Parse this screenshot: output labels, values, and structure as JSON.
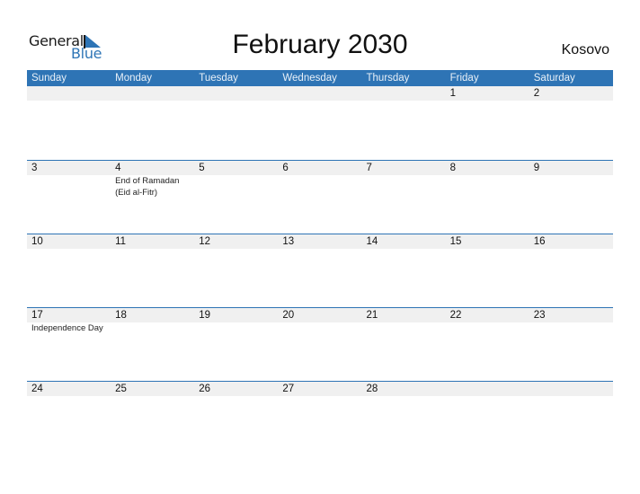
{
  "logo": {
    "part1": "General",
    "part2": "Blue"
  },
  "title": "February 2030",
  "country": "Kosovo",
  "colors": {
    "accent": "#2e74b5",
    "band": "#f0f0f0"
  },
  "weekdays": [
    "Sunday",
    "Monday",
    "Tuesday",
    "Wednesday",
    "Thursday",
    "Friday",
    "Saturday"
  ],
  "weeks": [
    [
      {
        "day": ""
      },
      {
        "day": ""
      },
      {
        "day": ""
      },
      {
        "day": ""
      },
      {
        "day": ""
      },
      {
        "day": "1"
      },
      {
        "day": "2"
      }
    ],
    [
      {
        "day": "3"
      },
      {
        "day": "4",
        "event": "End of Ramadan\n(Eid al-Fitr)"
      },
      {
        "day": "5"
      },
      {
        "day": "6"
      },
      {
        "day": "7"
      },
      {
        "day": "8"
      },
      {
        "day": "9"
      }
    ],
    [
      {
        "day": "10"
      },
      {
        "day": "11"
      },
      {
        "day": "12"
      },
      {
        "day": "13"
      },
      {
        "day": "14"
      },
      {
        "day": "15"
      },
      {
        "day": "16"
      }
    ],
    [
      {
        "day": "17",
        "event": "Independence Day"
      },
      {
        "day": "18"
      },
      {
        "day": "19"
      },
      {
        "day": "20"
      },
      {
        "day": "21"
      },
      {
        "day": "22"
      },
      {
        "day": "23"
      }
    ],
    [
      {
        "day": "24"
      },
      {
        "day": "25"
      },
      {
        "day": "26"
      },
      {
        "day": "27"
      },
      {
        "day": "28"
      },
      {
        "day": ""
      },
      {
        "day": ""
      }
    ]
  ]
}
